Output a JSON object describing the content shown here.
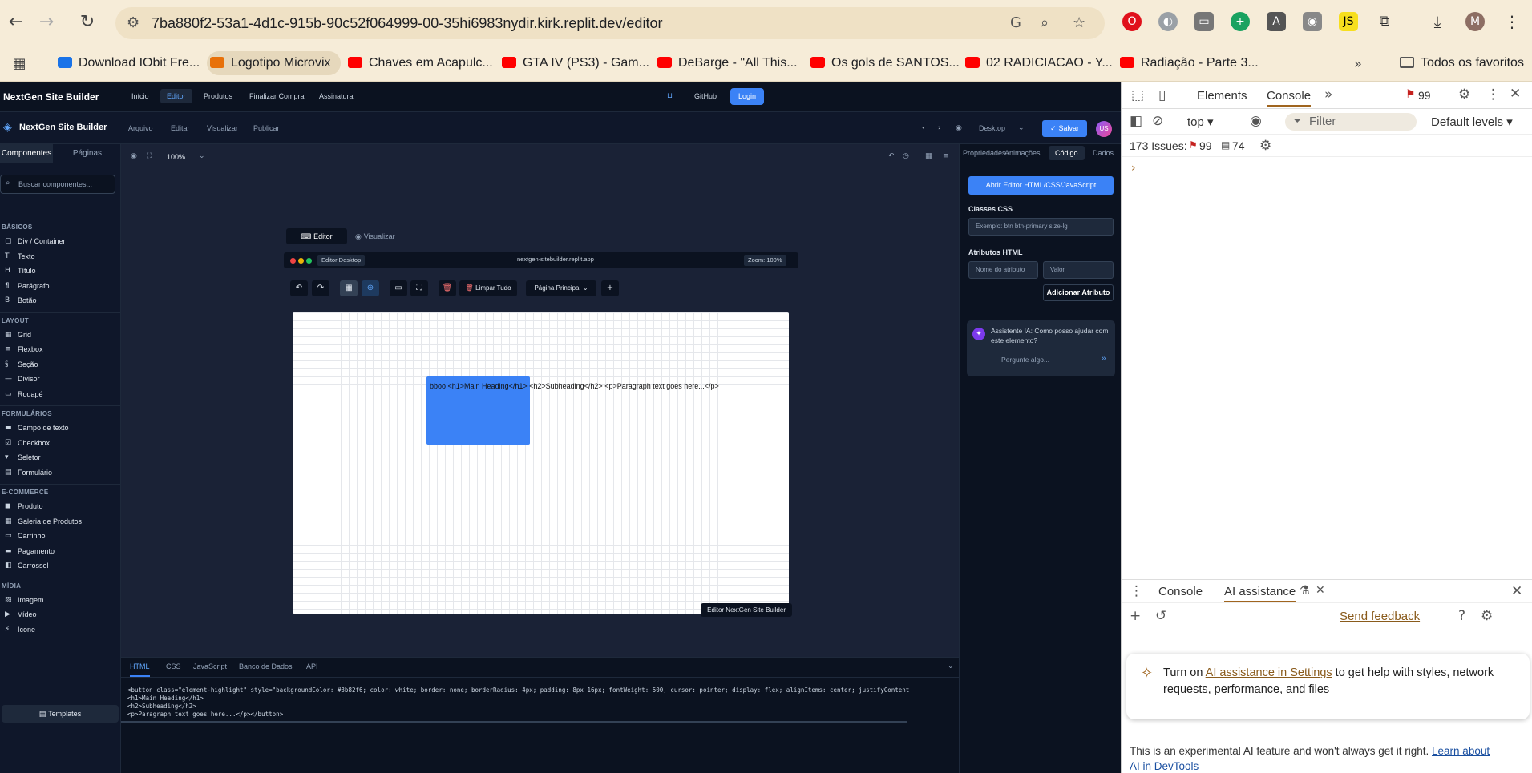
{
  "browser": {
    "url": "7ba880f2-53a1-4d1c-915b-90c52f064999-00-35hi6983nydir.kirk.replit.dev/editor",
    "avatar_letter": "M",
    "bookmarks": [
      {
        "label": "Download IObit Fre...",
        "color": "#1a73e8"
      },
      {
        "label": "Logotipo Microvix",
        "color": "#e8710a"
      },
      {
        "label": "Chaves em Acapulc...",
        "color": "#ff0000"
      },
      {
        "label": "GTA IV (PS3) - Gam...",
        "color": "#ff0000"
      },
      {
        "label": "DeBarge - \"All This...",
        "color": "#ff0000"
      },
      {
        "label": "Os gols de SANTOS...",
        "color": "#ff0000"
      },
      {
        "label": "02 RADICIACAO - Y...",
        "color": "#ff0000"
      },
      {
        "label": "Radiação - Parte 3...",
        "color": "#ff0000"
      }
    ],
    "all_bookmarks": "Todos os favoritos"
  },
  "app": {
    "brand": "NextGen Site Builder",
    "topnav": [
      "Início",
      "Editor",
      "Produtos",
      "Finalizar Compra",
      "Assinatura"
    ],
    "github": "GitHub",
    "login": "Login",
    "menu": [
      "Arquivo",
      "Editar",
      "Visualizar",
      "Publicar"
    ],
    "device": "Desktop",
    "save": "Salvar",
    "user_initials": "US",
    "zoom": "100%"
  },
  "sidebar": {
    "tabs": [
      "Componentes",
      "Páginas"
    ],
    "search_placeholder": "Buscar componentes...",
    "categories": [
      {
        "title": "BÁSICOS",
        "items": [
          {
            "icon": "▢",
            "label": "Div / Container"
          },
          {
            "icon": "T",
            "label": "Texto"
          },
          {
            "icon": "H",
            "label": "Título"
          },
          {
            "icon": "¶",
            "label": "Parágrafo"
          },
          {
            "icon": "B",
            "label": "Botão"
          }
        ]
      },
      {
        "title": "LAYOUT",
        "items": [
          {
            "icon": "▦",
            "label": "Grid"
          },
          {
            "icon": "≡",
            "label": "Flexbox"
          },
          {
            "icon": "§",
            "label": "Seção"
          },
          {
            "icon": "—",
            "label": "Divisor"
          },
          {
            "icon": "▭",
            "label": "Rodapé"
          }
        ]
      },
      {
        "title": "FORMULÁRIOS",
        "items": [
          {
            "icon": "▬",
            "label": "Campo de texto"
          },
          {
            "icon": "☑",
            "label": "Checkbox"
          },
          {
            "icon": "▾",
            "label": "Seletor"
          },
          {
            "icon": "▤",
            "label": "Formulário"
          }
        ]
      },
      {
        "title": "E-COMMERCE",
        "items": [
          {
            "icon": "◼",
            "label": "Produto"
          },
          {
            "icon": "▦",
            "label": "Galeria de Produtos"
          },
          {
            "icon": "▭",
            "label": "Carrinho"
          },
          {
            "icon": "▬",
            "label": "Pagamento"
          },
          {
            "icon": "◧",
            "label": "Carrossel"
          }
        ]
      },
      {
        "title": "MÍDIA",
        "items": [
          {
            "icon": "▨",
            "label": "Imagem"
          },
          {
            "icon": "▶",
            "label": "Vídeo"
          },
          {
            "icon": "⚡",
            "label": "Ícone"
          }
        ]
      }
    ],
    "templates": "Templates"
  },
  "workspace": {
    "tab_editor": "Editor",
    "tab_preview": "Visualizar",
    "browser_label": "Editor Desktop",
    "browser_url": "nextgen-sitebuilder.replit.app",
    "browser_zoom": "Zoom: 100%",
    "clear_all": "Limpar Tudo",
    "page_select": "Página Principal",
    "element_text": "bboo <h1>Main Heading</h1> <h2>Subheading</h2> <p>Paragraph text goes here...</p>",
    "footer_badge": "Editor NextGen Site Builder"
  },
  "props": {
    "tabs": [
      "Propriedades",
      "Animações",
      "Código",
      "Dados"
    ],
    "open_editor": "Abrir Editor HTML/CSS/JavaScript",
    "css_classes_label": "Classes CSS",
    "css_classes_placeholder": "Exemplo: btn btn-primary size-lg",
    "html_attrs_label": "Atributos HTML",
    "attr_name_placeholder": "Nome do atributo",
    "attr_value_placeholder": "Valor",
    "add_attr": "Adicionar Atributo",
    "ai_message": "Assistente IA: Como posso ajudar com este elemento?",
    "ai_placeholder": "Pergunte algo..."
  },
  "codepanel": {
    "tabs": [
      "HTML",
      "CSS",
      "JavaScript",
      "Banco de Dados",
      "API"
    ],
    "code": "<button class=\"element-highlight\" style=\"backgroundColor: #3b82f6; color: white; border: none; borderRadius: 4px; padding: 8px 16px; fontWeight: 500; cursor: pointer; display: flex; alignItems: center; justifyContent\n<h1>Main Heading</h1>\n<h2>Subheading</h2>\n<p>Paragraph text goes here...</p></button>"
  },
  "devtools": {
    "tabs": [
      "Elements",
      "Console"
    ],
    "issue_badge": "99",
    "context": "top",
    "filter_placeholder": "Filter",
    "levels": "Default levels",
    "issues_label": "173 Issues:",
    "issues_warn": "99",
    "issues_info": "74",
    "lower_tabs": [
      "Console",
      "AI assistance"
    ],
    "send_feedback": "Send feedback",
    "ai_card_pre": "Turn on ",
    "ai_card_link": "AI assistance in Settings",
    "ai_card_post": " to get help with styles, network requests, performance, and files",
    "disclaimer_pre": "This is an experimental AI feature and won't always get it right. ",
    "disclaimer_link": "Learn about AI in DevTools"
  },
  "colors": {
    "accent": "#3b82f6",
    "app_bg": "#0f172a",
    "chrome_bg": "#f6ecd8",
    "devtools_accent": "#a0651f"
  }
}
